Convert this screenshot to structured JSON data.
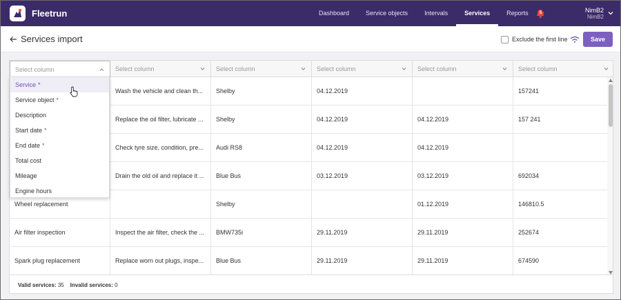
{
  "app": {
    "name": "Fleetrun"
  },
  "nav": {
    "items": [
      {
        "label": "Dashboard",
        "active": false
      },
      {
        "label": "Service objects",
        "active": false
      },
      {
        "label": "Intervals",
        "active": false
      },
      {
        "label": "Services",
        "active": true
      },
      {
        "label": "Reports",
        "active": false
      }
    ],
    "notifications_count": "5"
  },
  "user": {
    "name": "NimB2",
    "account": "NimB2"
  },
  "page": {
    "title": "Services import",
    "exclude_first_line_label": "Exclude the first line",
    "exclude_first_line_checked": false,
    "save_label": "Save"
  },
  "columns": [
    {
      "label": "Select column"
    },
    {
      "label": "Select column"
    },
    {
      "label": "Select column"
    },
    {
      "label": "Select column"
    },
    {
      "label": "Select column"
    },
    {
      "label": "Select column"
    }
  ],
  "rows": [
    [
      "",
      "Wash the vehicle and clean th...",
      "Shelby",
      "04.12.2019",
      "",
      "157241"
    ],
    [
      "",
      "Replace the oil filter, lubricate ...",
      "Shelby",
      "04.12.2019",
      "04.12.2019",
      "157 241"
    ],
    [
      "",
      "Check tyre size, condition, pre...",
      "Audi RS8",
      "04.12.2019",
      "04.12.2019",
      ""
    ],
    [
      "",
      "Drain the old oil and replace it ...",
      "Blue Bus",
      "03.12.2019",
      "03.12.2019",
      "692034"
    ],
    [
      "Wheel replacement",
      "",
      "Shelby",
      "",
      "01.12.2019",
      "146810.5"
    ],
    [
      "Air filter inspection",
      "Inspect the air filter, check the ...",
      "BMW735i",
      "29.11.2019",
      "29.11.2019",
      "252674"
    ],
    [
      "Spark plug replacement",
      "Replace worn out plugs, inspe...",
      "Blue Bus",
      "29.11.2019",
      "29.11.2019",
      "674590"
    ]
  ],
  "dropdown": {
    "options": [
      {
        "label": "Service",
        "required": true,
        "selected": true
      },
      {
        "label": "Service object",
        "required": true,
        "selected": false
      },
      {
        "label": "Description",
        "required": false,
        "selected": false
      },
      {
        "label": "Start date",
        "required": true,
        "selected": false
      },
      {
        "label": "End date",
        "required": true,
        "selected": false
      },
      {
        "label": "Total cost",
        "required": false,
        "selected": false
      },
      {
        "label": "Mileage",
        "required": false,
        "selected": false
      },
      {
        "label": "Engine hours",
        "required": false,
        "selected": false
      }
    ],
    "required_marker": "*"
  },
  "footer": {
    "valid_label": "Valid services:",
    "valid_count": "35",
    "invalid_label": "Invalid services:",
    "invalid_count": "0"
  },
  "colors": {
    "header_bg": "#3b2b68",
    "accent": "#7d5fc1",
    "badge": "#e8463a"
  }
}
